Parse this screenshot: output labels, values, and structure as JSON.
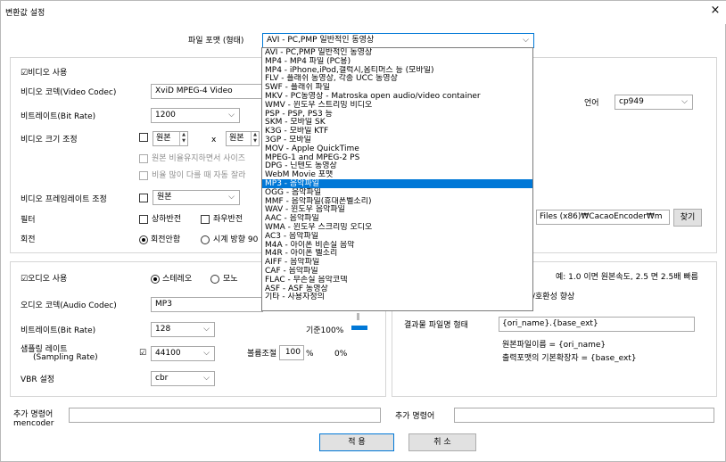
{
  "window": {
    "title": "변환값 설정",
    "close_glyph": "×"
  },
  "format": {
    "label": "파일 포맷 (형태)",
    "selected": "AVI - PC,PMP 일반적인 동영상"
  },
  "dropdown": {
    "items": [
      "AVI - PC,PMP 일반적인 동영상",
      "MP4 - MP4 파일 (PC용)",
      "MP4 - iPhone,iPod,갤럭시,옴티머스 등 (모바일)",
      "FLV - 플래쉬 동영상, 각종 UCC 동영상",
      "SWF - 플래쉬 파일",
      "MKV - PC동영상 - Matroska open audio/video container",
      "WMV - 윈도우 스트리밍 비디오",
      "PSP - PSP, PS3 등",
      "SKM - 모바일 SK",
      "K3G - 모바일 KTF",
      "3GP - 모바일",
      "MOV - Apple QuickTime",
      "MPEG-1 and MPEG-2 PS",
      "DPG - 닌텐도 동영상",
      "WebM Movie 포맷",
      "MP3 - 음악파일",
      "OGG - 음악파일",
      "MMF - 음악파일(휴대폰벨소리)",
      "WAV - 윈도우 음악파일",
      "AAC - 음악파일",
      "WMA - 윈도우 스크리밍 오디오",
      "AC3 - 음악파일",
      "M4A - 아이폰 비손실 음악",
      "M4R - 아이폰 벨소리",
      "AIFF - 음악파일",
      "CAF - 음악파일",
      "FLAC - 무손실 음악코덱",
      "ASF - ASF 동영상",
      "기타 - 사용자정의"
    ],
    "selected_index": 15
  },
  "video": {
    "use_label": "비디오 사용",
    "use_checked": "☑",
    "codec_label": "비디오 코덱(Video Codec)",
    "codec_value": "XviD MPEG-4 Video",
    "bitrate_label": "비트레이트(Bit Rate)",
    "bitrate_value": "1200",
    "size_label": "비디오 크기 조정",
    "size_w": "원본",
    "size_x": "x",
    "size_h": "원본",
    "keep_ratio": "원본 비율유지하면서 사이즈",
    "crop": "비율 많이 다를 때 자동 잘라",
    "framerate_label": "비디오 프레임레이트 조정",
    "framerate_value": "원본",
    "filter_label": "필터",
    "flip_v": "상하반전",
    "flip_h": "좌우반전",
    "rotate_label": "회전",
    "rotate_none": "회전안함",
    "rotate_cw": "시계 방향 90"
  },
  "lang": {
    "label": "언어",
    "value": "cp949"
  },
  "output": {
    "path": "Files (x86)₩CacaoEncoder₩m",
    "browse_label": "찾기"
  },
  "audio": {
    "use_label": "오디오 사용",
    "use_checked": "☑",
    "stereo_label": "스테레오",
    "mono_label": "모노",
    "codec_label": "오디오 코덱(Audio Codec)",
    "codec_value": "MP3",
    "bitrate_label": "비트레이트(Bit Rate)",
    "bitrate_value": "128",
    "sampling_label_1": "샘플링 레이트",
    "sampling_label_2": "(Sampling Rate)",
    "sampling_value": "44100",
    "volume_label": "볼륨조절",
    "volume_value": "100",
    "volume_unit": "%",
    "volume_pct": "0%",
    "speed_base": "기준100%",
    "vbr_label": "VBR 설정",
    "vbr_value": "cbr"
  },
  "speed": {
    "note": "예: 1.0 이면 원본속도, 2.5 면 2.5배 빠름",
    "compat": "/호환성 향상"
  },
  "filename": {
    "label": "결과물 파일명 형태",
    "value": "{ori_name}.{base_ext}",
    "help_1": "원본파일이름 = {ori_name}",
    "help_2": "출력포맷의 기본확장자 = {base_ext}"
  },
  "extra": {
    "mencoder_label_1": "추가 명령어",
    "mencoder_label_2": "mencoder",
    "right_label": "추가 명령어"
  },
  "buttons": {
    "apply": "적 용",
    "cancel": "취 소"
  }
}
